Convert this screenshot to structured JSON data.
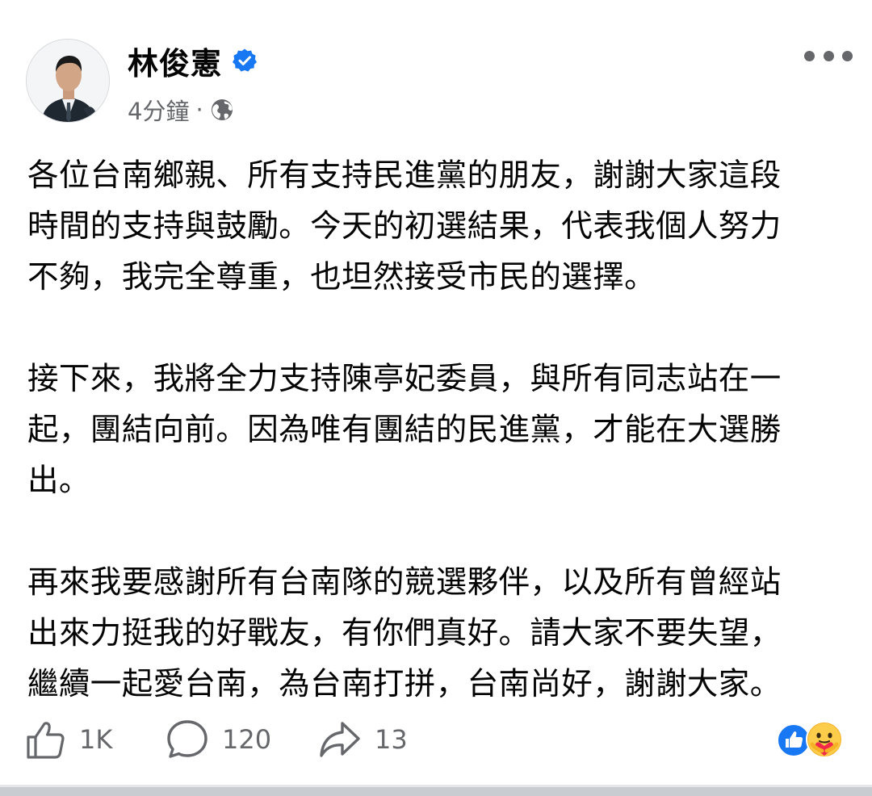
{
  "post": {
    "author": {
      "name": "林俊憲",
      "verified": true
    },
    "meta": {
      "timestamp": "4分鐘",
      "separator": "·",
      "audience_icon": "globe-icon"
    },
    "paragraphs": [
      "各位台南鄉親、所有支持民進黨的朋友，謝謝大家這段\n時間的支持與鼓勵。今天的初選結果，代表我個人努力\n不夠，我完全尊重，也坦然接受市民的選擇。",
      "接下來，我將全力支持陳亭妃委員，與所有同志站在一\n起，團結向前。因為唯有團結的民進黨，才能在大選勝\n出。",
      "再來我要感謝所有台南隊的競選夥伴，以及所有曾經站\n出來力挺我的好戰友，有你們真好。請大家不要失望，\n繼續一起愛台南，為台南打拼，台南尚好，謝謝大家。"
    ],
    "actions": {
      "like_count": "1K",
      "comment_count": "120",
      "share_count": "13"
    },
    "reactions": [
      "like-icon",
      "care-icon"
    ]
  },
  "colors": {
    "text": "#050505",
    "secondary_text": "#65676b",
    "verified_blue": "#1877f2",
    "separator": "#c9ccd1"
  },
  "icons": [
    "verified-badge-icon",
    "globe-icon",
    "more-icon",
    "thumbs-up-icon",
    "comment-icon",
    "share-icon",
    "like-icon",
    "care-icon"
  ]
}
